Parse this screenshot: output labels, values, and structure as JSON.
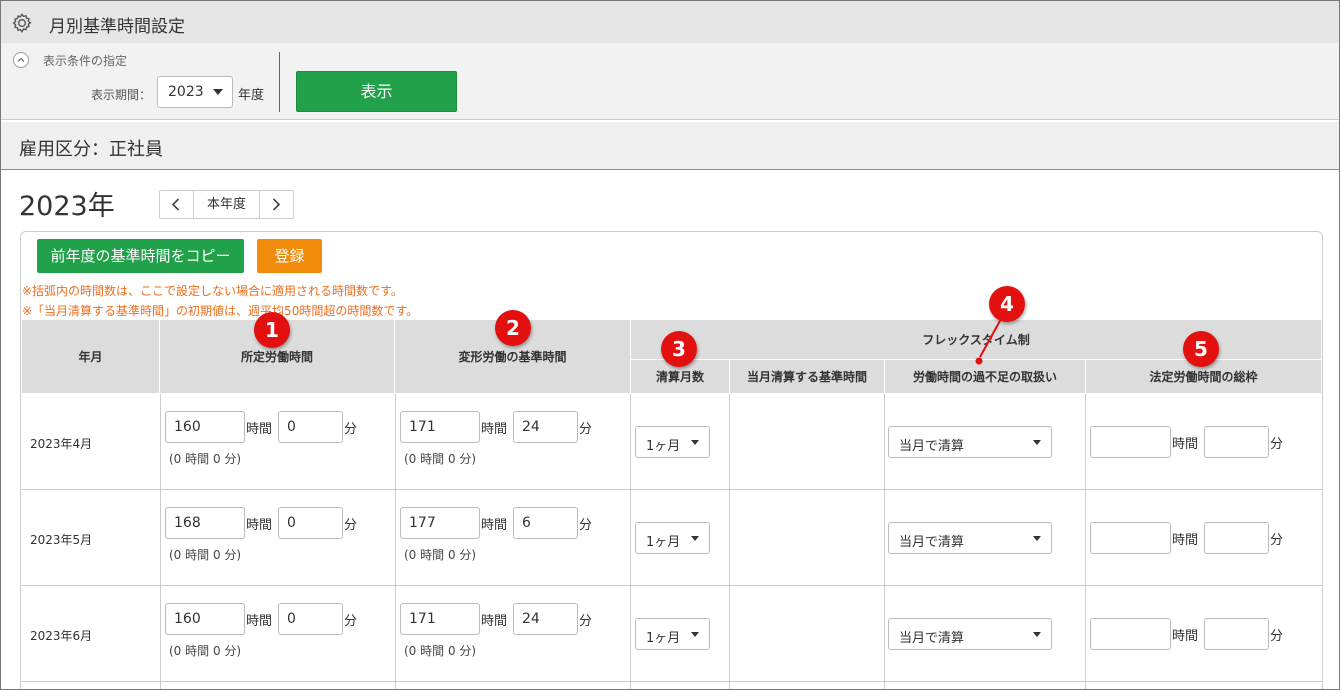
{
  "window": {
    "title": "月別基準時間設定",
    "icon": "gear-icon"
  },
  "filter": {
    "section_label": "表示条件の指定",
    "period_label": "表示期間：",
    "year_value": "2023",
    "year_suffix": "年度",
    "show_button": "表示"
  },
  "employment": {
    "label": "雇用区分：正社員"
  },
  "year_nav": {
    "title": "2023年",
    "current_label": "本年度"
  },
  "actions": {
    "copy_button": "前年度の基準時間をコピー",
    "register_button": "登録"
  },
  "notes": [
    "※括弧内の時間数は、ここで設定しない場合に適用される時間数です。",
    "※「当月清算する基準時間」の初期値は、週平均50時間超の時間数です。"
  ],
  "table": {
    "headers": {
      "year_month": "年月",
      "scheduled_hours": "所定労働時間",
      "variable_hours": "変形労働の基準時間",
      "flex_group": "フレックスタイム制",
      "settlement_months": "清算月数",
      "monthly_settlement_hours": "当月清算する基準時間",
      "excess_deficit_handling": "労働時間の過不足の取扱い",
      "statutory_total": "法定労働時間の総枠"
    },
    "units": {
      "hour": "時間",
      "minute": "分"
    },
    "rows": [
      {
        "month": "2023年4月",
        "sched_h": "160",
        "sched_m": "0",
        "sched_default": "(0 時間 0 分)",
        "var_h": "171",
        "var_m": "24",
        "var_default": "(0 時間 0 分)",
        "settle": "1ヶ月",
        "handling": "当月で清算",
        "legal_h": "",
        "legal_m": ""
      },
      {
        "month": "2023年5月",
        "sched_h": "168",
        "sched_m": "0",
        "sched_default": "(0 時間 0 分)",
        "var_h": "177",
        "var_m": "6",
        "var_default": "(0 時間 0 分)",
        "settle": "1ヶ月",
        "handling": "当月で清算",
        "legal_h": "",
        "legal_m": ""
      },
      {
        "month": "2023年6月",
        "sched_h": "160",
        "sched_m": "0",
        "sched_default": "(0 時間 0 分)",
        "var_h": "171",
        "var_m": "24",
        "var_default": "(0 時間 0 分)",
        "settle": "1ヶ月",
        "handling": "当月で清算",
        "legal_h": "",
        "legal_m": ""
      }
    ]
  },
  "callouts": [
    "1",
    "2",
    "3",
    "4",
    "5"
  ],
  "colors": {
    "primary_green": "#21a14a",
    "register_orange": "#f08c0a",
    "note_orange": "#ee6e1e",
    "callout_red": "#e31010",
    "header_gray": "#dcdcdc"
  }
}
